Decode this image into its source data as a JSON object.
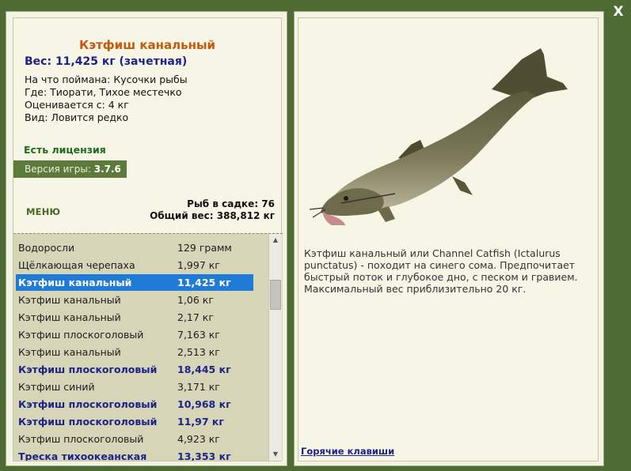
{
  "close_label": "X",
  "fish": {
    "title": "Кэтфиш канальный",
    "weight_line": "Вес: 11,425 кг (зачетная)",
    "caught_with": "На что поймана: Кусочки рыбы",
    "location": "Где: Тиорати, Тихое местечко",
    "valued_from": "Оценивается с: 4 кг",
    "rarity": "Вид: Ловится редко",
    "description": "Кэтфиш канальный или Channel Catfish (Ictalurus punctatus) - походит на синего сома. Предпочитает быстрый поток и глубокое дно, с песком и гравием. Максимальный вес приблизительно 20 кг."
  },
  "license": "Есть лицензия",
  "version": {
    "label": "Версия игры:",
    "value": "3.7.6"
  },
  "menu_label": "МЕНЮ",
  "cage": {
    "count_line": "Рыб в садке: 76",
    "total_line": "Общий вес: 388,812 кг"
  },
  "list": [
    {
      "name": "Водоросли",
      "weight": "129 грамм",
      "style": "normal"
    },
    {
      "name": "Щёлкающая черепаха",
      "weight": "1,997 кг",
      "style": "normal"
    },
    {
      "name": "Кэтфиш канальный",
      "weight": "11,425 кг",
      "style": "selected"
    },
    {
      "name": "Кэтфиш канальный",
      "weight": "1,06 кг",
      "style": "normal"
    },
    {
      "name": "Кэтфиш канальный",
      "weight": "2,17 кг",
      "style": "normal"
    },
    {
      "name": "Кэтфиш плоскоголовый",
      "weight": "7,163 кг",
      "style": "normal"
    },
    {
      "name": "Кэтфиш канальный",
      "weight": "2,513 кг",
      "style": "normal"
    },
    {
      "name": "Кэтфиш плоскоголовый",
      "weight": "18,445 кг",
      "style": "bold"
    },
    {
      "name": "Кэтфиш синий",
      "weight": "3,171 кг",
      "style": "normal"
    },
    {
      "name": "Кэтфиш плоскоголовый",
      "weight": "10,968 кг",
      "style": "bold"
    },
    {
      "name": "Кэтфиш плоскоголовый",
      "weight": "11,97 кг",
      "style": "bold"
    },
    {
      "name": "Кэтфиш плоскоголовый",
      "weight": "4,923 кг",
      "style": "normal"
    },
    {
      "name": "Треска тихоокеанская",
      "weight": "13,353 кг",
      "style": "bold"
    }
  ],
  "hotkeys_label": "Горячие клавиши",
  "colors": {
    "background": "#4d6b32",
    "title": "#c45a0c",
    "accent_blue": "#1d2387",
    "selection": "#1f7ad8",
    "license_green": "#1e6a1e"
  }
}
